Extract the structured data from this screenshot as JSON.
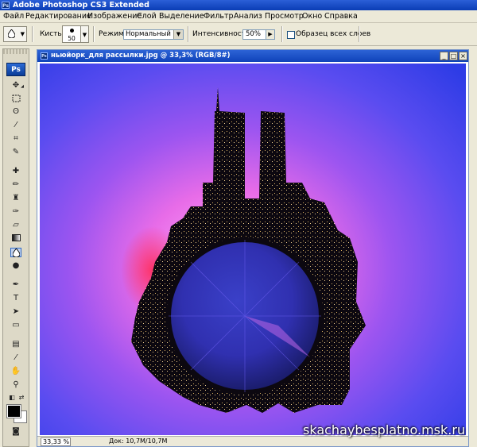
{
  "app": {
    "title": "Adobe Photoshop CS3 Extended",
    "ps_logo": "Ps"
  },
  "menu": [
    "Файл",
    "Редактирование",
    "Изображение",
    "Слой",
    "Выделение",
    "Фильтр",
    "Анализ",
    "Просмотр",
    "Окно",
    "Справка"
  ],
  "options": {
    "brush_label": "Кисть:",
    "brush_size": "50",
    "mode_label": "Режим:",
    "mode_value": "Нормальный",
    "intensity_label": "Интенсивность:",
    "intensity_value": "50%",
    "sample_all_layers_label": "Образец всех слоев",
    "sample_all_layers_checked": false
  },
  "document": {
    "title": "ньюйорк_для рассылки.jpg @ 33,3% (RGB/8#)",
    "zoom": "33,33 %",
    "doc_info": "Док: 10,7M/10,7M"
  },
  "toolbox": {
    "active_tool": "blur-tool",
    "foreground_color": "#000000",
    "background_color": "#ffffff"
  },
  "watermark": "skachaybesplatno.msk.ru"
}
